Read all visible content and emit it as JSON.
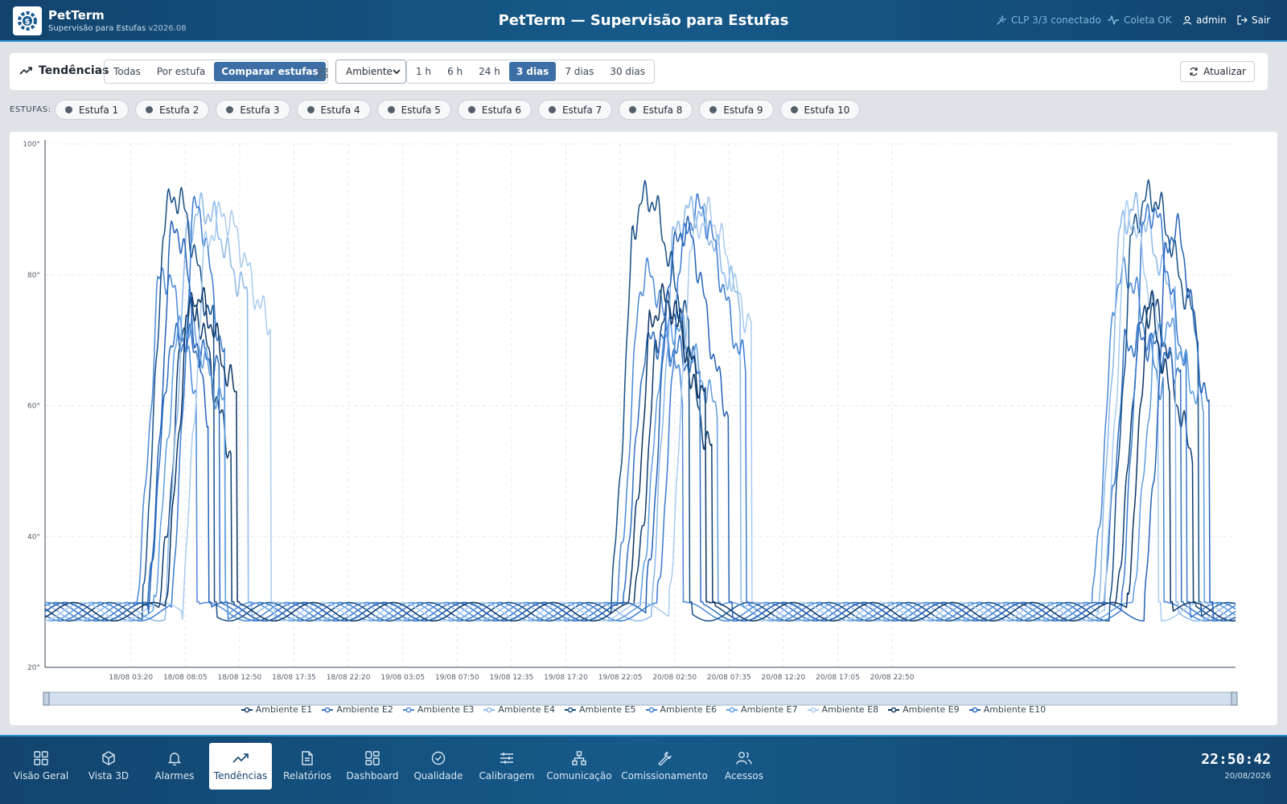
{
  "header": {
    "app_name": "PetTerm",
    "subtitle": "Supervisão para Estufas",
    "version": "v2026.08",
    "title": "PetTerm — Supervisão para Estufas",
    "status_clp": "CLP 3/3 conectado",
    "status_coleta": "Coleta OK",
    "user": "admin",
    "logout": "Sair"
  },
  "toolbar": {
    "title": "Tendências",
    "view_options": [
      "Todas",
      "Por estufa",
      "Comparar estufas"
    ],
    "active_view": "Comparar estufas",
    "variable_select": "Ambiente",
    "ranges": [
      "1 h",
      "6 h",
      "24 h",
      "3 dias",
      "7 dias",
      "30 dias"
    ],
    "active_range": "3 dias",
    "refresh": "Atualizar"
  },
  "chips_label": "ESTUFAS:",
  "chips": [
    "Estufa 1",
    "Estufa 2",
    "Estufa 3",
    "Estufa 4",
    "Estufa 5",
    "Estufa 6",
    "Estufa 7",
    "Estufa 8",
    "Estufa 9",
    "Estufa 10"
  ],
  "chart_data": {
    "type": "line",
    "title": "",
    "xlabel": "",
    "ylabel": "",
    "ylim": [
      20,
      100
    ],
    "y_ticks": [
      "20°",
      "40°",
      "60°",
      "80°",
      "100°"
    ],
    "x_ticks": [
      "18/08 03:20",
      "18/08 08:05",
      "18/08 12:50",
      "18/08 17:35",
      "18/08 22:20",
      "19/08 03:05",
      "19/08 07:50",
      "19/08 12:35",
      "19/08 17:20",
      "19/08 22:05",
      "20/08 02:50",
      "20/08 07:35",
      "20/08 12:20",
      "20/08 17:05",
      "20/08 22:50"
    ],
    "grid": true,
    "legend_position": "bottom",
    "series": [
      {
        "name": "Ambiente E1",
        "color": "#0f3d6e",
        "peak": 75,
        "plateau": 50,
        "on": [
          10.0,
          51.5,
          93.5
        ],
        "off": [
          16.5,
          58.5,
          100.5
        ]
      },
      {
        "name": "Ambiente E2",
        "color": "#2f6fc0",
        "peak": 70,
        "plateau": 65,
        "on": [
          9.0,
          50.5,
          92.5
        ],
        "off": [
          15.5,
          57.5,
          99.5
        ]
      },
      {
        "name": "Ambiente E3",
        "color": "#4a88d6",
        "peak": 80,
        "plateau": 60,
        "on": [
          8.0,
          50.0,
          91.5
        ],
        "off": [
          13.5,
          56.0,
          98.0
        ]
      },
      {
        "name": "Ambiente E4",
        "color": "#8cb8e8",
        "peak": 90,
        "plateau": 75,
        "on": [
          10.5,
          53.0,
          92.0
        ],
        "off": [
          18.0,
          61.0,
          99.0
        ]
      },
      {
        "name": "Ambiente E5",
        "color": "#164f86",
        "peak": 92,
        "plateau": 70,
        "on": [
          8.5,
          49.5,
          93.0
        ],
        "off": [
          15.0,
          56.5,
          101.0
        ]
      },
      {
        "name": "Ambiente E6",
        "color": "#3a7bd0",
        "peak": 90,
        "plateau": 63,
        "on": [
          11.0,
          53.5,
          94.0
        ],
        "off": [
          16.0,
          61.5,
          100.0
        ]
      },
      {
        "name": "Ambiente E7",
        "color": "#5f9ee0",
        "peak": 72,
        "plateau": 58,
        "on": [
          9.5,
          52.0,
          95.0
        ],
        "off": [
          16.0,
          59.0,
          101.5
        ]
      },
      {
        "name": "Ambiente E8",
        "color": "#a9cbef",
        "peak": 89,
        "plateau": 70,
        "on": [
          12.0,
          54.5,
          92.5
        ],
        "off": [
          20.0,
          62.0,
          97.5
        ]
      },
      {
        "name": "Ambiente E9",
        "color": "#0b3463",
        "peak": 76,
        "plateau": 60,
        "on": [
          10.5,
          51.0,
          94.5
        ],
        "off": [
          17.0,
          58.0,
          98.5
        ]
      },
      {
        "name": "Ambiente E10",
        "color": "#2563b8",
        "peak": 87,
        "plateau": 55,
        "on": [
          9.0,
          52.5,
          96.0
        ],
        "off": [
          14.5,
          60.0,
          102.0
        ]
      }
    ]
  },
  "nav": [
    "Visão Geral",
    "Vista 3D",
    "Alarmes",
    "Tendências",
    "Relatórios",
    "Dashboard",
    "Qualidade",
    "Calibragem",
    "Comunicação",
    "Comissionamento",
    "Acessos"
  ],
  "nav_active": "Tendências",
  "clock": {
    "time": "22:50:42",
    "date": "20/08/2026"
  }
}
